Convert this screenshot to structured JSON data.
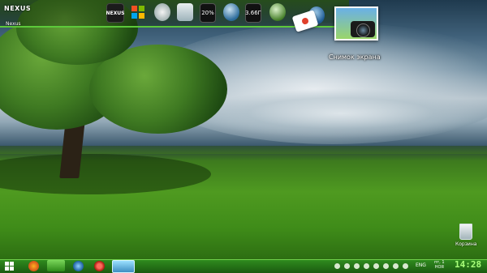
{
  "dock": {
    "logo": "NEXUS",
    "logo_sub": "Nexus",
    "nexus_icon_text": "NEXUS",
    "meter1_value": "20%",
    "meter2_value": "3.66Г",
    "items": [
      {
        "name": "nexus-icon"
      },
      {
        "name": "windows-icon"
      },
      {
        "name": "clock-icon"
      },
      {
        "name": "recycle-bin-icon"
      },
      {
        "name": "cpu-meter-icon"
      },
      {
        "name": "globe-icon"
      },
      {
        "name": "memory-meter-icon"
      },
      {
        "name": "green-orb-icon"
      },
      {
        "name": "mail-icon"
      },
      {
        "name": "browser-globe-icon"
      }
    ]
  },
  "desktop": {
    "screenshot_label": "Снимок экрана",
    "recycle_label": "Корзина"
  },
  "taskbar": {
    "apps": [
      "firefox-icon",
      "explorer-icon",
      "thunderbird-icon",
      "opera-icon",
      "screenshot-app-icon"
    ],
    "language": "ENG",
    "date_line1": "пт, 1",
    "date_line2": "НОЯ",
    "time": "14:28"
  },
  "colors": {
    "taskbar": "#2f8a1e",
    "accent": "#5cc93a",
    "clock": "#a9ff7a"
  }
}
